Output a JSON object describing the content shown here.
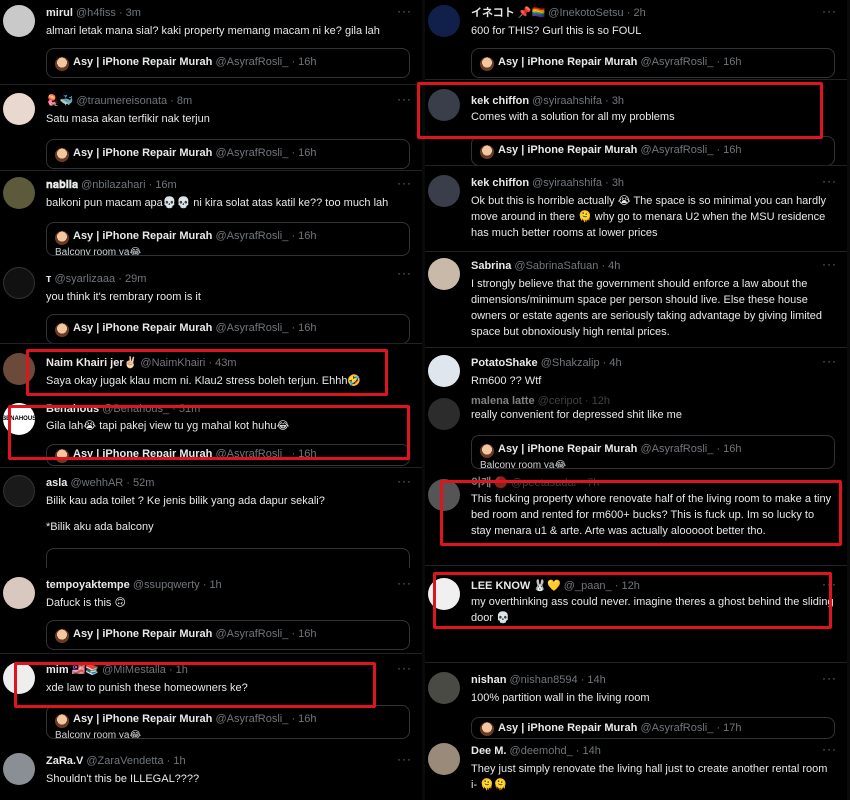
{
  "quoted": {
    "name": "Asy | iPhone Repair Murah",
    "handle": "@AsyrafRosli_",
    "avatar_color": "#7a4a2a"
  },
  "left_tweets": [
    {
      "name": "mirul",
      "handle": "@h4fiss",
      "time": "3m",
      "text": "almari letak mana sial? kaki property memang macam ni ke? gila lah",
      "quote_time": "16h",
      "avatar_color": "#c9c9c9",
      "avatar_icon": "person-icon"
    },
    {
      "name": "🪼🐳",
      "handle": "@traumereisonata",
      "time": "8m",
      "text": "Satu masa akan terfikir nak terjun",
      "quote_time": "16h",
      "avatar_color": "#e9d8cf",
      "avatar_icon": "person-icon"
    },
    {
      "name": "𝐧𝐚𝐛𝐢𝐥𝐚",
      "handle": "@nbilazahari",
      "time": "16m",
      "text": "balkoni pun macam apa💀💀 ni kira solat atas katil ke?? too much lah",
      "quote_time": "16h",
      "peek": "Balcony room ya😂",
      "avatar_color": "#5c5a3a",
      "avatar_icon": "person-icon"
    },
    {
      "name": "ᴛ",
      "handle": "@syarlizaaa",
      "time": "29m",
      "text": "you think it's rembrary room is it",
      "quote_time": "16h",
      "avatar_color": "#111111",
      "avatar_icon": "person-icon"
    },
    {
      "name": "Naim Khairi jer✌🏻",
      "handle": "@NaimKhairi",
      "time": "43m",
      "text": "Saya okay jugak klau mcm ni. Klau2 stress boleh terjun. Ehhh🤣",
      "avatar_color": "#6b4a3a",
      "avatar_icon": "person-icon"
    },
    {
      "name": "Benahous",
      "handle": "@Benahous_",
      "time": "51m",
      "text": "Gila lah😭 tapi pakej view tu yg mahal kot huhu😂",
      "quote_time": "16h",
      "avatar_color": "#ffffff",
      "avatar_icon": "benahous-logo-icon"
    },
    {
      "name": "asla",
      "handle": "@wehhAR",
      "time": "52m",
      "text": "Bilik kau ada toilet ? Ke jenis bilik yang ada dapur sekali?",
      "text2": "*Bilik aku ada balcony",
      "avatar_color": "#1a1a1a",
      "avatar_icon": "person-icon"
    },
    {
      "name": "tempoyaktempe",
      "handle": "@ssupqwerty",
      "time": "1h",
      "text": "Dafuck is this 🙃",
      "quote_time": "16h",
      "avatar_color": "#d8c8c0",
      "avatar_icon": "person-icon"
    },
    {
      "name": "mim 🇲🇾📚",
      "handle": "@MiMestalla",
      "time": "1h",
      "text": "xde law to punish these homeowners ke?",
      "quote_time": "16h",
      "peek": "Balcony room ya😂",
      "avatar_color": "#eeeeee",
      "avatar_icon": "person-icon"
    },
    {
      "name": "ZaRa.V",
      "handle": "@ZaraVendetta",
      "time": "1h",
      "text": "Shouldn't this be ILLEGAL????",
      "avatar_color": "#8a8f96",
      "avatar_icon": "person-icon"
    }
  ],
  "right_tweets": [
    {
      "name": "イネコト 📌🏳️‍🌈",
      "handle": "@InekotoSetsu",
      "time": "2h",
      "text": "600 for THIS? Gurl this is so FOUL",
      "quote_time": "16h",
      "avatar_color": "#10204a",
      "avatar_icon": "person-icon"
    },
    {
      "name": "kek chiffon",
      "handle": "@syiraahshifa",
      "time": "3h",
      "text": "Comes with a solution for all my problems",
      "quote_time": "16h",
      "avatar_color": "#3a3d4a",
      "avatar_icon": "person-icon"
    },
    {
      "name": "kek chiffon",
      "handle": "@syiraahshifa",
      "time": "3h",
      "text": "Ok but this is horrible actually 😭 The space is so minimal you can hardly move around in there 🫠 why go to menara U2 when the MSU residence has much better rooms at lower prices",
      "avatar_color": "#3a3d4a",
      "avatar_icon": "person-icon"
    },
    {
      "name": "Sabrina",
      "handle": "@SabrinaSafuan",
      "time": "4h",
      "text": "I strongly believe that the government should enforce a law about the dimensions/minimum space per person should live. Else these house owners or estate agents are seriously taking advantage by giving limited space but obnoxiously high rental prices.",
      "avatar_color": "#c9b9a8",
      "avatar_icon": "person-icon"
    },
    {
      "name": "PotatoShake",
      "handle": "@Shakzalip",
      "time": "4h",
      "text": "Rm600 ?? Wtf",
      "avatar_color": "#dfe6ee",
      "avatar_icon": "person-icon"
    },
    {
      "name": "malena latte",
      "handle": "@ceripot",
      "time": "12h",
      "text": "really convenient for depressed shit like me",
      "quote_time": "16h",
      "peek": "Balcony room ya😂",
      "avatar_color": "#2c2c2c",
      "avatar_icon": "person-icon"
    },
    {
      "name": "이게 🔴",
      "handle": "@peetasadar",
      "time": "7h",
      "text": "This fucking property whore renovate half of the living room to make a tiny bed room and rented for rm600+ bucks? This is fuck up. Im so lucky to stay menara u1 & arte. Arte was actually alooooot better tho.",
      "avatar_color": "#555555",
      "avatar_icon": "person-icon"
    },
    {
      "name": "LEE KNOW 🐰💛",
      "handle": "@_paan_",
      "time": "12h",
      "text": "my overthinking ass could never. imagine theres a ghost behind the sliding door 💀",
      "avatar_color": "#f0f0f0",
      "avatar_icon": "person-icon"
    },
    {
      "name": "nishan",
      "handle": "@nishan8594",
      "time": "14h",
      "text": "100% partition wall in the living room",
      "quote_time": "17h",
      "avatar_color": "#4a4a44",
      "avatar_icon": "person-icon"
    },
    {
      "name": "Dee M.",
      "handle": "@deemohd_",
      "time": "14h",
      "text": "They just simply renovate the living hall just to create another rental room i- 🫠🫠",
      "avatar_color": "#9a8a7a",
      "avatar_icon": "person-icon"
    }
  ]
}
